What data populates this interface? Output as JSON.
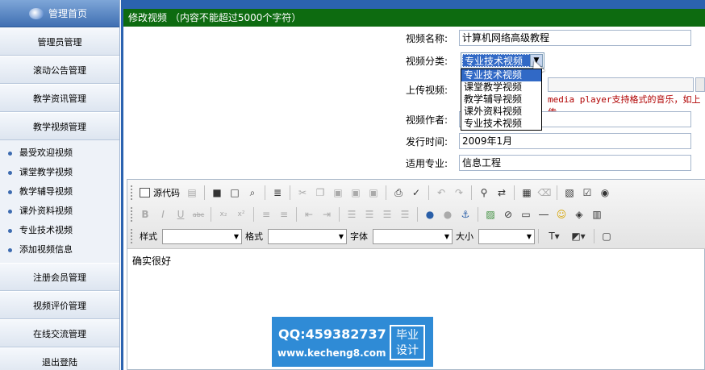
{
  "sidebar": {
    "home_label": "管理首页",
    "items": [
      {
        "label": "管理员管理"
      },
      {
        "label": "滚动公告管理"
      },
      {
        "label": "教学资讯管理"
      },
      {
        "label": "教学视频管理"
      }
    ],
    "sub_items": [
      {
        "label": "最受欢迎视频"
      },
      {
        "label": "课堂教学视频"
      },
      {
        "label": "教学辅导视频"
      },
      {
        "label": "课外资料视频"
      },
      {
        "label": "专业技术视频"
      },
      {
        "label": "添加视频信息"
      }
    ],
    "items_after": [
      {
        "label": "注册会员管理"
      },
      {
        "label": "视频评价管理"
      },
      {
        "label": "在线交流管理"
      },
      {
        "label": "退出登陆"
      }
    ]
  },
  "header": {
    "title": "修改视频 （内容不能超过5000个字符）"
  },
  "form": {
    "name_label": "视频名称:",
    "name_value": "计算机网络高级教程",
    "category_label": "视频分类:",
    "category_value": "专业技术视频",
    "category_options": [
      "专业技术视频",
      "课堂教学视频",
      "教学辅导视频",
      "课外资料视频",
      "专业技术视频"
    ],
    "upload_label": "上传视频:",
    "upload_hint": "media player支持格式的音乐，如上传",
    "author_label": "视频作者:",
    "author_value": "",
    "date_label": "发行时间:",
    "date_value": "2009年1月",
    "major_label": "适用专业:",
    "major_value": "信息工程"
  },
  "editor": {
    "source_label": "源代码",
    "style_label": "样式",
    "format_label": "格式",
    "font_label": "字体",
    "size_label": "大小",
    "content": "确实很好"
  },
  "watermark": {
    "qq": "QQ:459382737",
    "url": "www.kecheng8.com",
    "badge_line1": "毕业",
    "badge_line2": "设计"
  }
}
